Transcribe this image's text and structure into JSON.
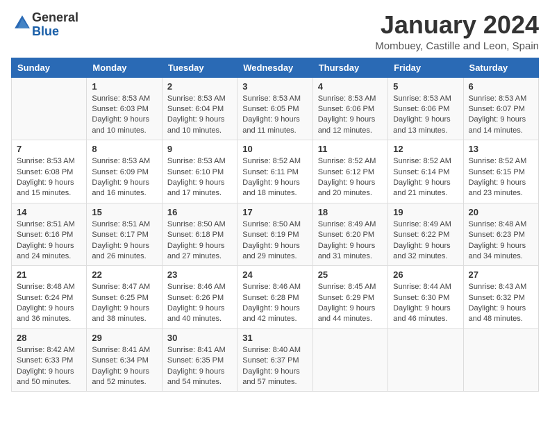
{
  "header": {
    "logo_general": "General",
    "logo_blue": "Blue",
    "month_title": "January 2024",
    "location": "Mombuey, Castille and Leon, Spain"
  },
  "columns": [
    "Sunday",
    "Monday",
    "Tuesday",
    "Wednesday",
    "Thursday",
    "Friday",
    "Saturday"
  ],
  "weeks": [
    [
      {
        "day": "",
        "sunrise": "",
        "sunset": "",
        "daylight": ""
      },
      {
        "day": "1",
        "sunrise": "Sunrise: 8:53 AM",
        "sunset": "Sunset: 6:03 PM",
        "daylight": "Daylight: 9 hours and 10 minutes."
      },
      {
        "day": "2",
        "sunrise": "Sunrise: 8:53 AM",
        "sunset": "Sunset: 6:04 PM",
        "daylight": "Daylight: 9 hours and 10 minutes."
      },
      {
        "day": "3",
        "sunrise": "Sunrise: 8:53 AM",
        "sunset": "Sunset: 6:05 PM",
        "daylight": "Daylight: 9 hours and 11 minutes."
      },
      {
        "day": "4",
        "sunrise": "Sunrise: 8:53 AM",
        "sunset": "Sunset: 6:06 PM",
        "daylight": "Daylight: 9 hours and 12 minutes."
      },
      {
        "day": "5",
        "sunrise": "Sunrise: 8:53 AM",
        "sunset": "Sunset: 6:06 PM",
        "daylight": "Daylight: 9 hours and 13 minutes."
      },
      {
        "day": "6",
        "sunrise": "Sunrise: 8:53 AM",
        "sunset": "Sunset: 6:07 PM",
        "daylight": "Daylight: 9 hours and 14 minutes."
      }
    ],
    [
      {
        "day": "7",
        "sunrise": "Sunrise: 8:53 AM",
        "sunset": "Sunset: 6:08 PM",
        "daylight": "Daylight: 9 hours and 15 minutes."
      },
      {
        "day": "8",
        "sunrise": "Sunrise: 8:53 AM",
        "sunset": "Sunset: 6:09 PM",
        "daylight": "Daylight: 9 hours and 16 minutes."
      },
      {
        "day": "9",
        "sunrise": "Sunrise: 8:53 AM",
        "sunset": "Sunset: 6:10 PM",
        "daylight": "Daylight: 9 hours and 17 minutes."
      },
      {
        "day": "10",
        "sunrise": "Sunrise: 8:52 AM",
        "sunset": "Sunset: 6:11 PM",
        "daylight": "Daylight: 9 hours and 18 minutes."
      },
      {
        "day": "11",
        "sunrise": "Sunrise: 8:52 AM",
        "sunset": "Sunset: 6:12 PM",
        "daylight": "Daylight: 9 hours and 20 minutes."
      },
      {
        "day": "12",
        "sunrise": "Sunrise: 8:52 AM",
        "sunset": "Sunset: 6:14 PM",
        "daylight": "Daylight: 9 hours and 21 minutes."
      },
      {
        "day": "13",
        "sunrise": "Sunrise: 8:52 AM",
        "sunset": "Sunset: 6:15 PM",
        "daylight": "Daylight: 9 hours and 23 minutes."
      }
    ],
    [
      {
        "day": "14",
        "sunrise": "Sunrise: 8:51 AM",
        "sunset": "Sunset: 6:16 PM",
        "daylight": "Daylight: 9 hours and 24 minutes."
      },
      {
        "day": "15",
        "sunrise": "Sunrise: 8:51 AM",
        "sunset": "Sunset: 6:17 PM",
        "daylight": "Daylight: 9 hours and 26 minutes."
      },
      {
        "day": "16",
        "sunrise": "Sunrise: 8:50 AM",
        "sunset": "Sunset: 6:18 PM",
        "daylight": "Daylight: 9 hours and 27 minutes."
      },
      {
        "day": "17",
        "sunrise": "Sunrise: 8:50 AM",
        "sunset": "Sunset: 6:19 PM",
        "daylight": "Daylight: 9 hours and 29 minutes."
      },
      {
        "day": "18",
        "sunrise": "Sunrise: 8:49 AM",
        "sunset": "Sunset: 6:20 PM",
        "daylight": "Daylight: 9 hours and 31 minutes."
      },
      {
        "day": "19",
        "sunrise": "Sunrise: 8:49 AM",
        "sunset": "Sunset: 6:22 PM",
        "daylight": "Daylight: 9 hours and 32 minutes."
      },
      {
        "day": "20",
        "sunrise": "Sunrise: 8:48 AM",
        "sunset": "Sunset: 6:23 PM",
        "daylight": "Daylight: 9 hours and 34 minutes."
      }
    ],
    [
      {
        "day": "21",
        "sunrise": "Sunrise: 8:48 AM",
        "sunset": "Sunset: 6:24 PM",
        "daylight": "Daylight: 9 hours and 36 minutes."
      },
      {
        "day": "22",
        "sunrise": "Sunrise: 8:47 AM",
        "sunset": "Sunset: 6:25 PM",
        "daylight": "Daylight: 9 hours and 38 minutes."
      },
      {
        "day": "23",
        "sunrise": "Sunrise: 8:46 AM",
        "sunset": "Sunset: 6:26 PM",
        "daylight": "Daylight: 9 hours and 40 minutes."
      },
      {
        "day": "24",
        "sunrise": "Sunrise: 8:46 AM",
        "sunset": "Sunset: 6:28 PM",
        "daylight": "Daylight: 9 hours and 42 minutes."
      },
      {
        "day": "25",
        "sunrise": "Sunrise: 8:45 AM",
        "sunset": "Sunset: 6:29 PM",
        "daylight": "Daylight: 9 hours and 44 minutes."
      },
      {
        "day": "26",
        "sunrise": "Sunrise: 8:44 AM",
        "sunset": "Sunset: 6:30 PM",
        "daylight": "Daylight: 9 hours and 46 minutes."
      },
      {
        "day": "27",
        "sunrise": "Sunrise: 8:43 AM",
        "sunset": "Sunset: 6:32 PM",
        "daylight": "Daylight: 9 hours and 48 minutes."
      }
    ],
    [
      {
        "day": "28",
        "sunrise": "Sunrise: 8:42 AM",
        "sunset": "Sunset: 6:33 PM",
        "daylight": "Daylight: 9 hours and 50 minutes."
      },
      {
        "day": "29",
        "sunrise": "Sunrise: 8:41 AM",
        "sunset": "Sunset: 6:34 PM",
        "daylight": "Daylight: 9 hours and 52 minutes."
      },
      {
        "day": "30",
        "sunrise": "Sunrise: 8:41 AM",
        "sunset": "Sunset: 6:35 PM",
        "daylight": "Daylight: 9 hours and 54 minutes."
      },
      {
        "day": "31",
        "sunrise": "Sunrise: 8:40 AM",
        "sunset": "Sunset: 6:37 PM",
        "daylight": "Daylight: 9 hours and 57 minutes."
      },
      {
        "day": "",
        "sunrise": "",
        "sunset": "",
        "daylight": ""
      },
      {
        "day": "",
        "sunrise": "",
        "sunset": "",
        "daylight": ""
      },
      {
        "day": "",
        "sunrise": "",
        "sunset": "",
        "daylight": ""
      }
    ]
  ]
}
